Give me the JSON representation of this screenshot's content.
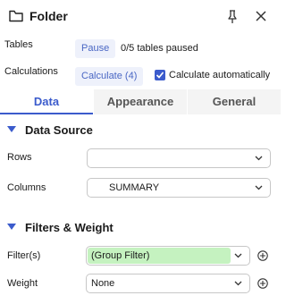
{
  "header": {
    "title": "Folder",
    "icons": [
      "folder-icon",
      "pin-icon",
      "close-icon"
    ]
  },
  "tables": {
    "label": "Tables",
    "pause_button": "Pause",
    "status": "0/5 tables paused"
  },
  "calculations": {
    "label": "Calculations",
    "calculate_button": "Calculate (4)",
    "auto_checkbox_label": "Calculate automatically",
    "auto_checked": true
  },
  "tabs": [
    {
      "label": "Data",
      "active": true
    },
    {
      "label": "Appearance",
      "active": false
    },
    {
      "label": "General",
      "active": false
    }
  ],
  "data_source": {
    "title": "Data Source",
    "rows_label": "Rows",
    "rows_value": "",
    "columns_label": "Columns",
    "columns_value": "SUMMARY"
  },
  "filters_weight": {
    "title": "Filters & Weight",
    "filters_label": "Filter(s)",
    "filters_value": "(Group Filter)",
    "weight_label": "Weight",
    "weight_value": "None"
  },
  "colors": {
    "accent": "#3b5bcc",
    "button_bg": "#eef1fb",
    "filter_fill": "#c5f2c0",
    "tab_bg": "#f4f4f4"
  }
}
